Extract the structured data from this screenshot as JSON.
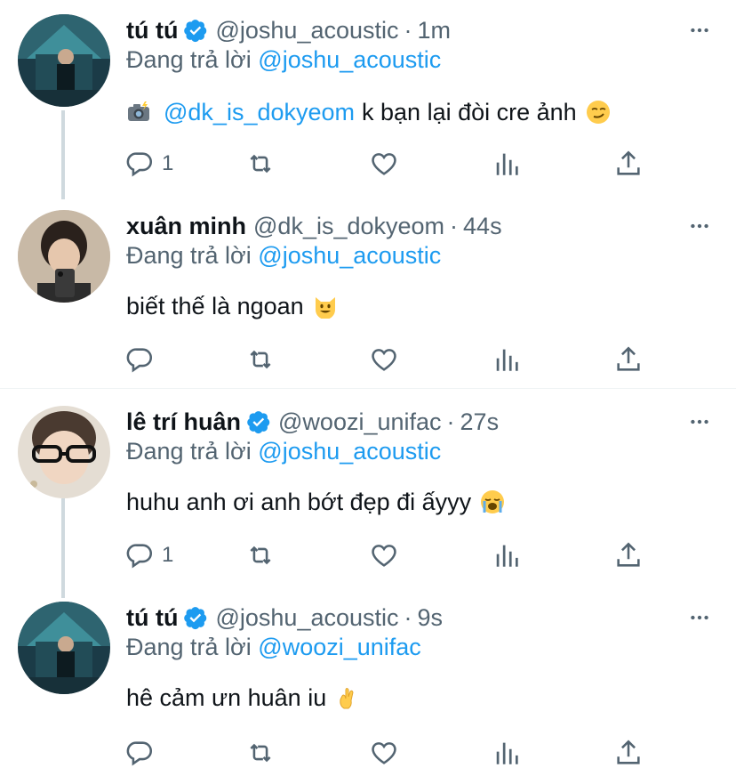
{
  "colors": {
    "accent": "#1d9bf0",
    "secondary": "#536471",
    "text": "#0f1419",
    "thread_line": "#cfd9de"
  },
  "tweets": [
    {
      "name": "tú tú",
      "verified": true,
      "handle": "@joshu_acoustic",
      "separator": "·",
      "time": "1m",
      "reply_prefix": "Đang trả lời",
      "reply_to": "@joshu_acoustic",
      "text_prefix_emoji": "camera-flash",
      "mention": "@dk_is_dokyeom",
      "text": "k bạn lại đòi cre ảnh",
      "text_suffix_emoji": "smirking-face",
      "reply_count": "1"
    },
    {
      "name": "xuân minh",
      "verified": false,
      "handle": "@dk_is_dokyeom",
      "separator": "·",
      "time": "44s",
      "reply_prefix": "Đang trả lời",
      "reply_to": "@joshu_acoustic",
      "text": "biết thế là ngoan",
      "text_suffix_emoji": "grinning-cat",
      "reply_count": ""
    },
    {
      "name": "lê trí huân",
      "verified": true,
      "handle": "@woozi_unifac",
      "separator": "·",
      "time": "27s",
      "reply_prefix": "Đang trả lời",
      "reply_to": "@joshu_acoustic",
      "text": "huhu anh ơi anh bớt đẹp đi ấyyy",
      "text_suffix_emoji": "loudly-crying-face",
      "reply_count": "1"
    },
    {
      "name": "tú tú",
      "verified": true,
      "handle": "@joshu_acoustic",
      "separator": "·",
      "time": "9s",
      "reply_prefix": "Đang trả lời",
      "reply_to": "@woozi_unifac",
      "text": "hê cảm ưn huân iu",
      "text_suffix_emoji": "crossed-fingers",
      "reply_count": ""
    }
  ]
}
